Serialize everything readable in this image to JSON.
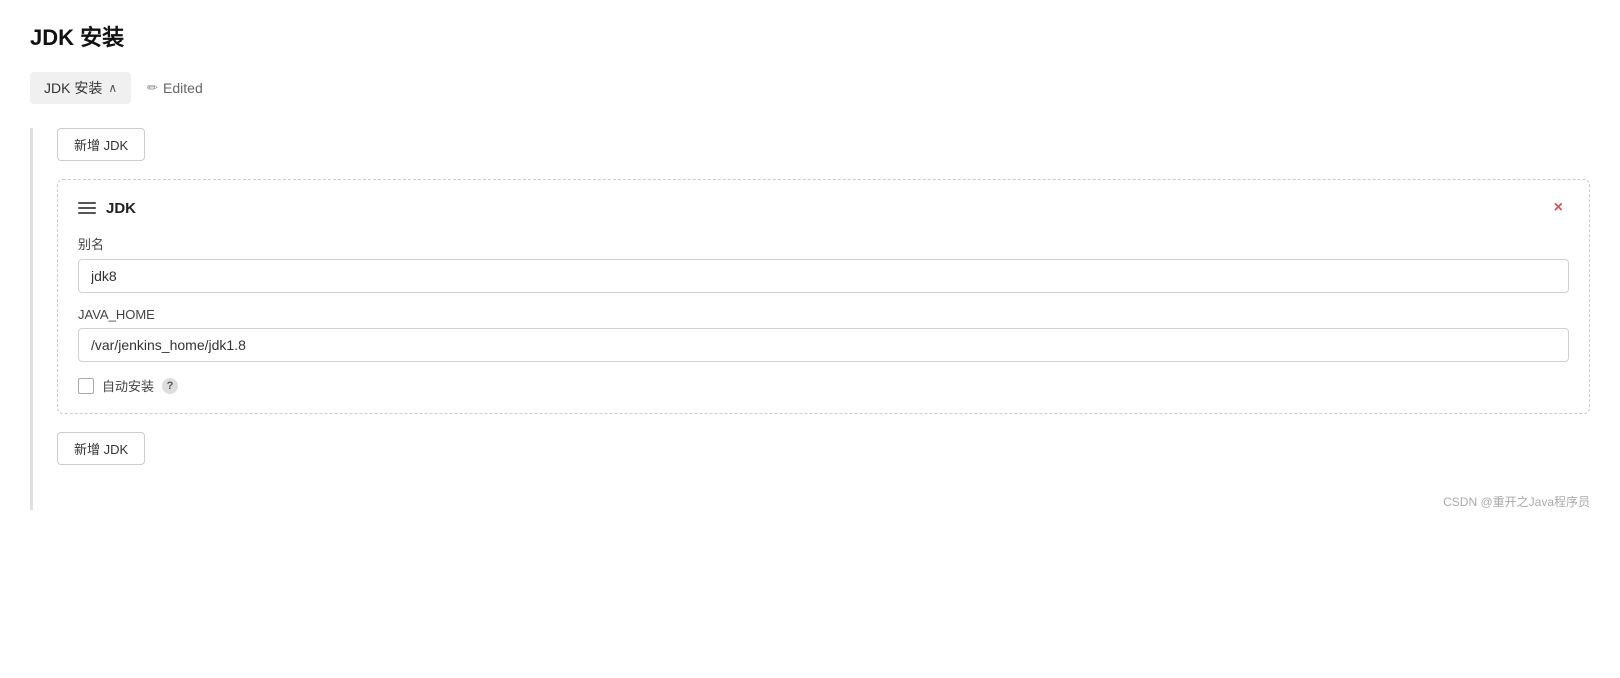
{
  "page": {
    "title": "JDK 安装"
  },
  "breadcrumb": {
    "tab_label": "JDK 安装",
    "chevron": "∧",
    "edited_label": "Edited",
    "pencil": "✏"
  },
  "main": {
    "add_btn_top": "新增 JDK",
    "add_btn_bottom": "新增 JDK"
  },
  "jdk_card": {
    "title": "JDK",
    "alias_label": "别名",
    "alias_value": "jdk8",
    "java_home_label": "JAVA_HOME",
    "java_home_value": "/var/jenkins_home/jdk1.8",
    "auto_install_label": "自动安装",
    "help_label": "?",
    "close_label": "×"
  },
  "watermark": {
    "text": "CSDN @重开之Java程序员"
  }
}
